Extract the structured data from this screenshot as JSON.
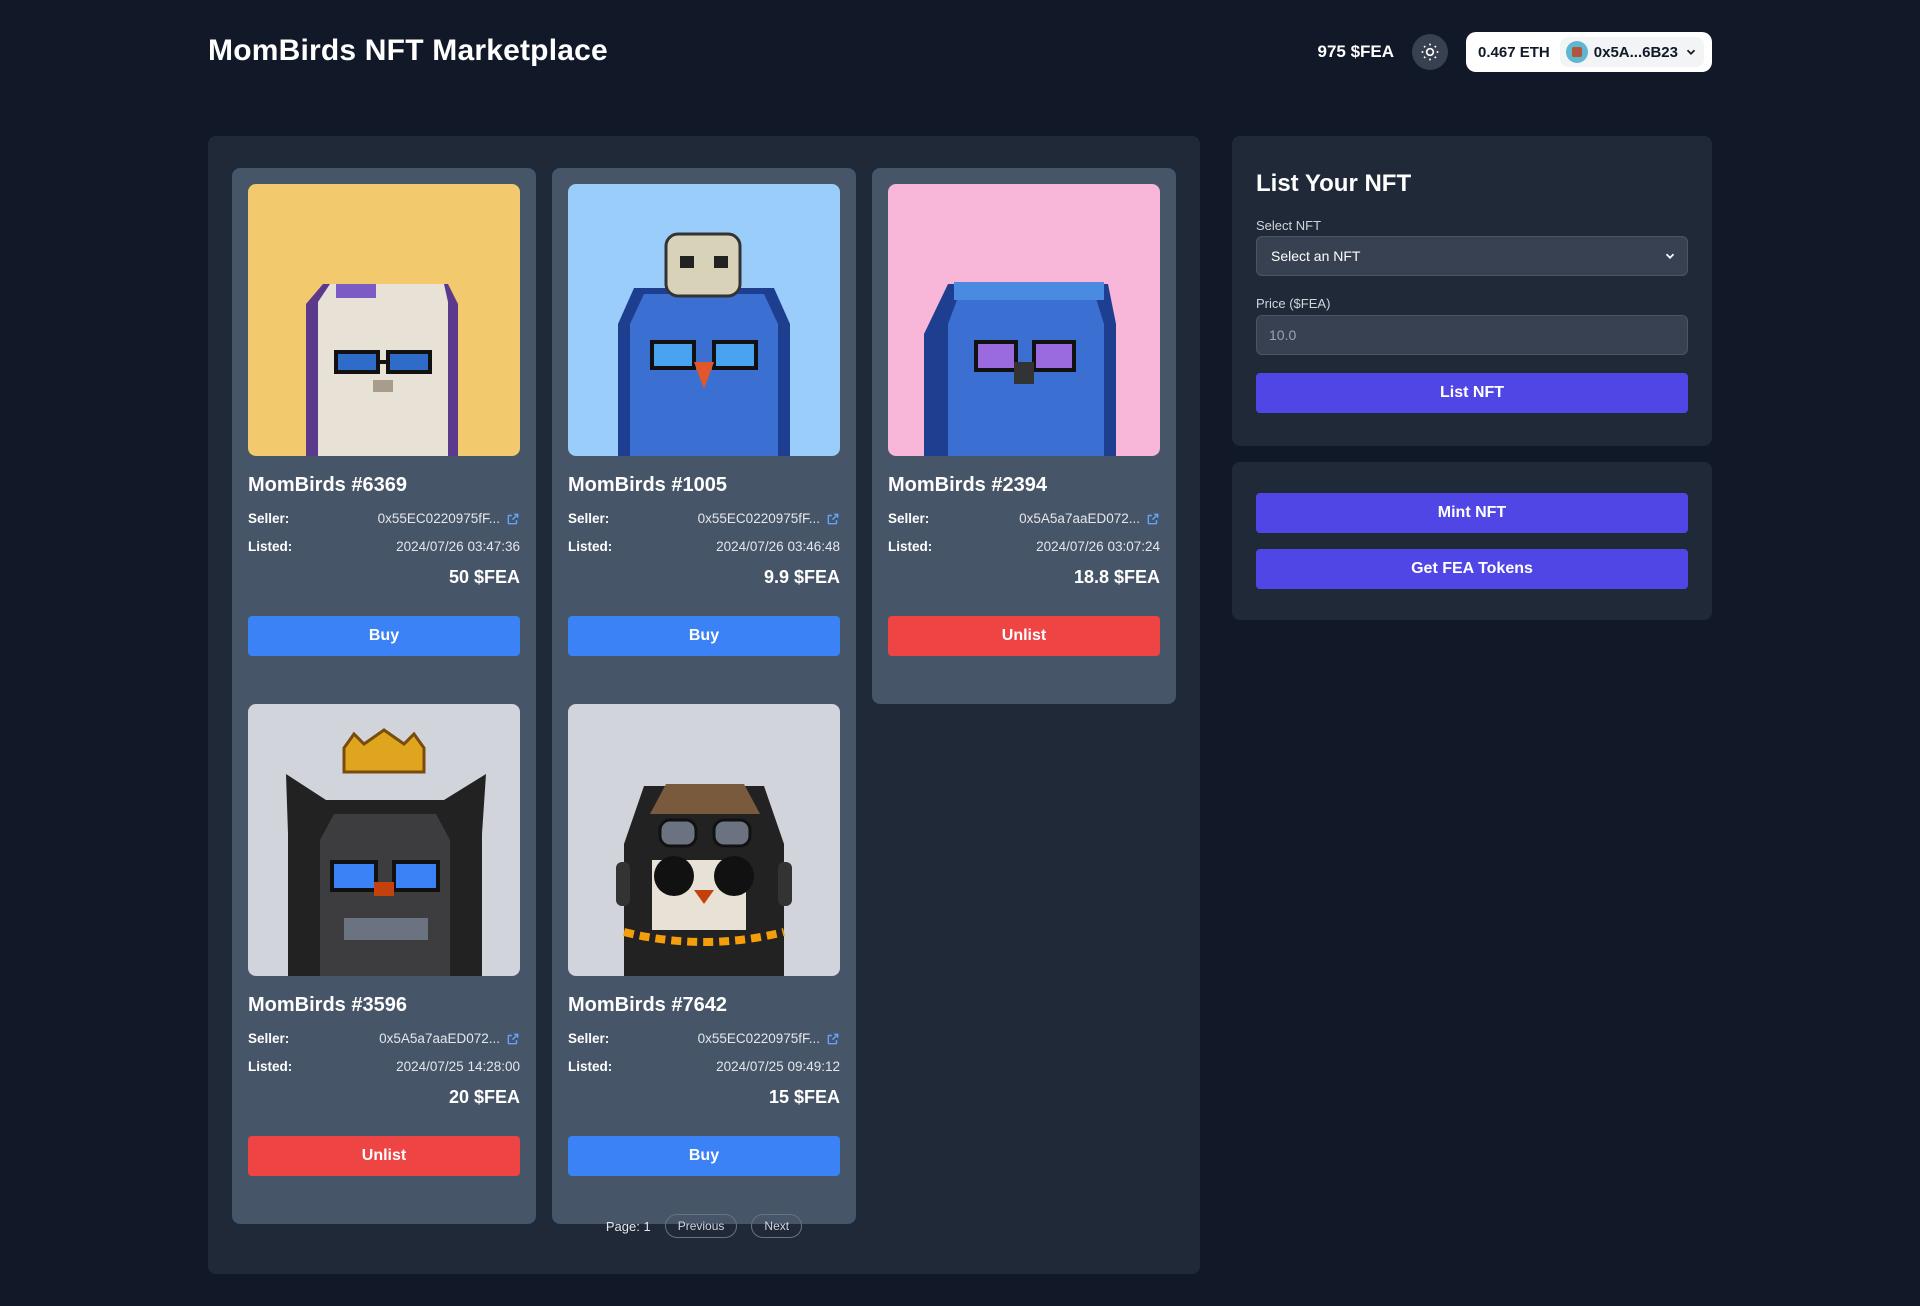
{
  "header": {
    "title": "MomBirds NFT Marketplace",
    "fea_balance": "975 $FEA",
    "eth_balance": "0.467 ETH",
    "wallet_address": "0x5A...6B23"
  },
  "listing_labels": {
    "seller": "Seller:",
    "listed": "Listed:"
  },
  "listings": [
    {
      "name": "MomBirds #6369",
      "seller": "0x55EC0220975fF...",
      "listed": "2024/07/26 03:47:36",
      "price": "50 $FEA",
      "action": "Buy",
      "bg": "#f3c96d"
    },
    {
      "name": "MomBirds #1005",
      "seller": "0x55EC0220975fF...",
      "listed": "2024/07/26 03:46:48",
      "price": "9.9 $FEA",
      "action": "Buy",
      "bg": "#9bcdfb"
    },
    {
      "name": "MomBirds #2394",
      "seller": "0x5A5a7aaED072...",
      "listed": "2024/07/26 03:07:24",
      "price": "18.8 $FEA",
      "action": "Unlist",
      "bg": "#f8b6d8"
    },
    {
      "name": "MomBirds #3596",
      "seller": "0x5A5a7aaED072...",
      "listed": "2024/07/25 14:28:00",
      "price": "20 $FEA",
      "action": "Unlist",
      "bg": "#d1d5db"
    },
    {
      "name": "MomBirds #7642",
      "seller": "0x55EC0220975fF...",
      "listed": "2024/07/25 09:49:12",
      "price": "15 $FEA",
      "action": "Buy",
      "bg": "#d1d5db"
    }
  ],
  "pagination": {
    "label": "Page: 1",
    "previous": "Previous",
    "next": "Next"
  },
  "list_form": {
    "title": "List Your NFT",
    "select_label": "Select NFT",
    "select_value": "Select an NFT",
    "price_label": "Price ($FEA)",
    "price_placeholder": "10.0",
    "submit": "List NFT"
  },
  "actions": {
    "mint": "Mint NFT",
    "get_tokens": "Get FEA Tokens"
  }
}
